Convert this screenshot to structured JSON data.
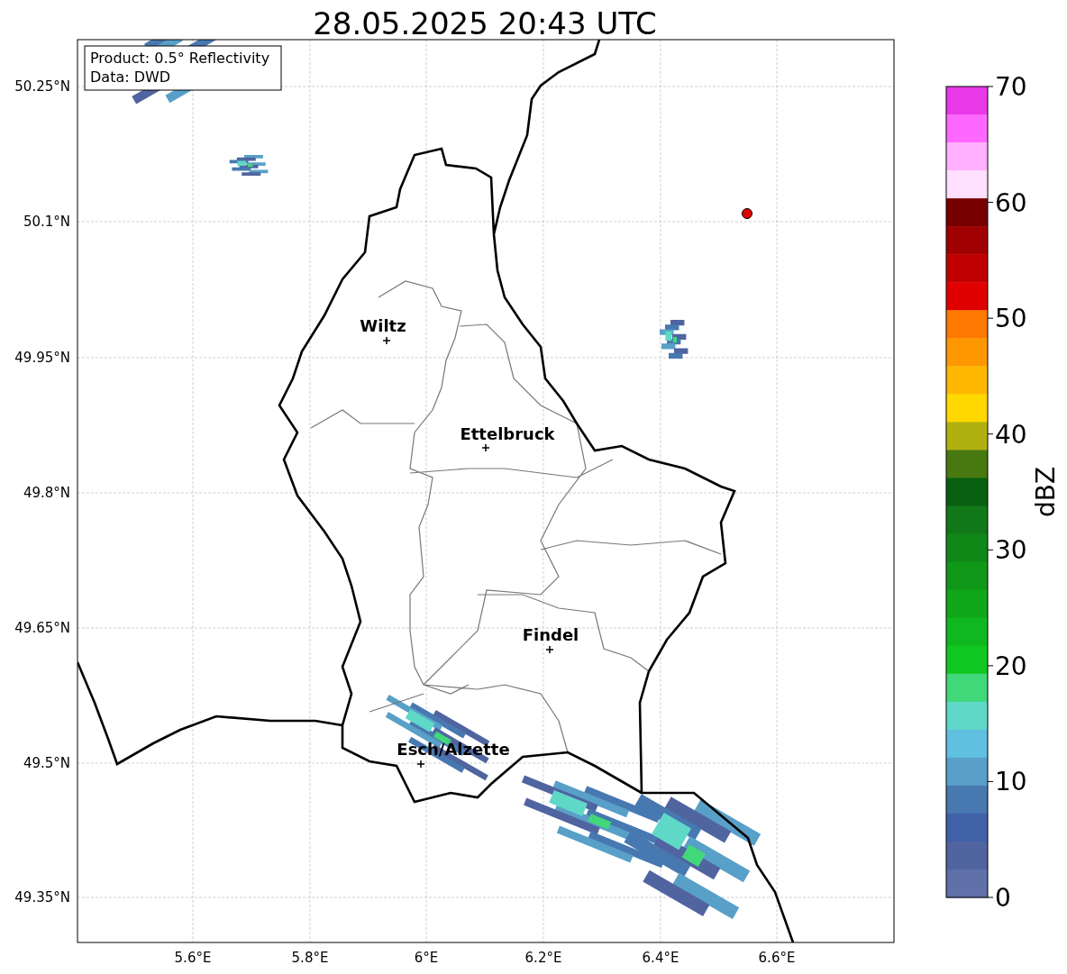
{
  "title": "28.05.2025 20:43 UTC",
  "info_box": {
    "lines": [
      "Product: 0.5° Reflectivity",
      "Data: DWD"
    ]
  },
  "map": {
    "x_ticks": [
      "5.6°E",
      "5.8°E",
      "6°E",
      "6.2°E",
      "6.4°E",
      "6.6°E"
    ],
    "y_ticks": [
      "50.25°N",
      "50.1°N",
      "49.95°N",
      "49.8°N",
      "49.65°N",
      "49.5°N",
      "49.35°N"
    ],
    "cities": [
      {
        "name": "Wiltz"
      },
      {
        "name": "Ettelbruck"
      },
      {
        "name": "Findel"
      },
      {
        "name": "Esch/Alzette"
      }
    ],
    "marker": {
      "color": "#e00000"
    }
  },
  "colorbar": {
    "label": "dBZ",
    "ticks": [
      "70",
      "60",
      "50",
      "40",
      "30",
      "20",
      "10",
      "0"
    ],
    "segments": [
      {
        "color": "#e838e8"
      },
      {
        "color": "#ff68ff"
      },
      {
        "color": "#ffb0ff"
      },
      {
        "color": "#ffe0ff"
      },
      {
        "color": "#780000"
      },
      {
        "color": "#a00000"
      },
      {
        "color": "#c00000"
      },
      {
        "color": "#e00000"
      },
      {
        "color": "#ff7800"
      },
      {
        "color": "#ff9800"
      },
      {
        "color": "#ffb800"
      },
      {
        "color": "#ffd800"
      },
      {
        "color": "#b0b010"
      },
      {
        "color": "#487810"
      },
      {
        "color": "#086010"
      },
      {
        "color": "#107818"
      },
      {
        "color": "#108818"
      },
      {
        "color": "#109818"
      },
      {
        "color": "#10a818"
      },
      {
        "color": "#10b820"
      },
      {
        "color": "#10c820"
      },
      {
        "color": "#40d878"
      },
      {
        "color": "#60d8c8"
      },
      {
        "color": "#60c0e0"
      },
      {
        "color": "#58a0c8"
      },
      {
        "color": "#4878b0"
      },
      {
        "color": "#4060a8"
      },
      {
        "color": "#5064a0"
      },
      {
        "color": "#6070a8"
      }
    ]
  }
}
